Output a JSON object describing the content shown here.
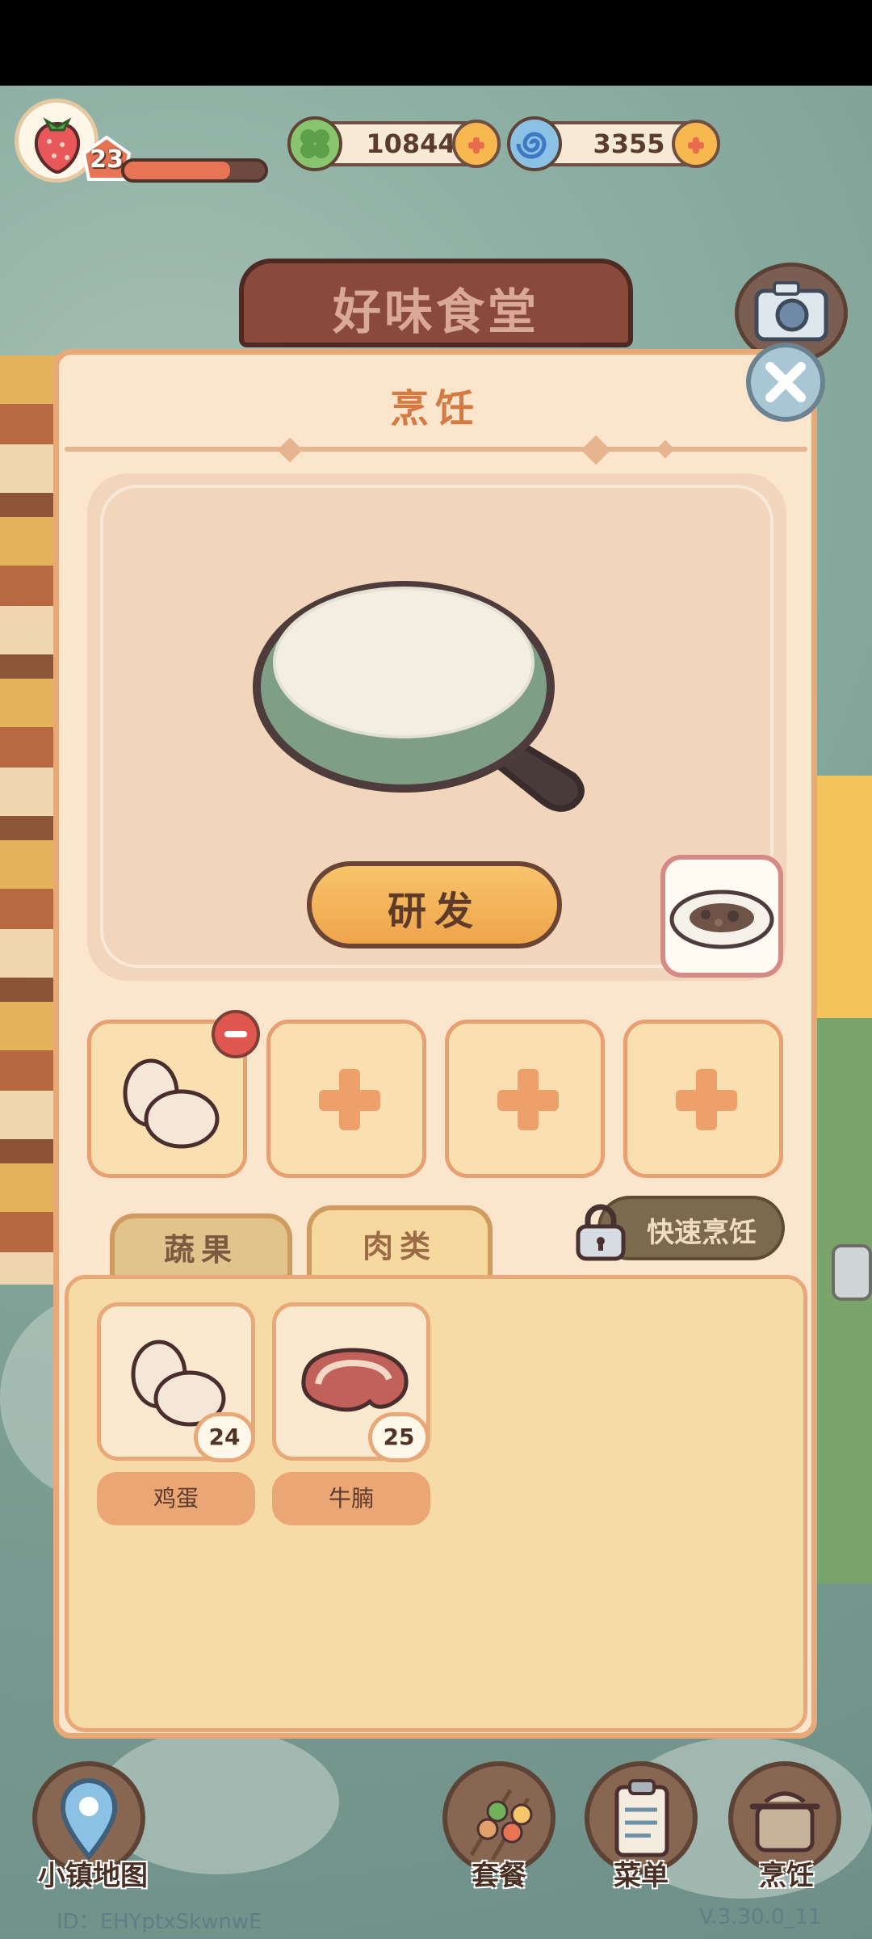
{
  "hud": {
    "level": "23",
    "xp_progress": 0.75,
    "currency_green": "10844",
    "currency_blue": "3355"
  },
  "sign": {
    "title": "好味食堂"
  },
  "panel": {
    "title": "烹饪",
    "research_label": "研发",
    "tabs": [
      {
        "label": "蔬果"
      },
      {
        "label": "肉类"
      }
    ],
    "quick_cook_label": "快速烹饪"
  },
  "ingredients": [
    {
      "name": "鸡蛋",
      "count": "24",
      "icon": "egg-icon"
    },
    {
      "name": "牛腩",
      "count": "25",
      "icon": "beef-icon"
    }
  ],
  "bottom_nav": {
    "map_label": "小镇地图",
    "set_meal_label": "套餐",
    "menu_label": "菜单",
    "cook_label": "烹饪"
  },
  "footer": {
    "id_text": "ID：EHYptxSkwnwE",
    "version": "V.3.30.0_11"
  },
  "colors": {
    "accent_orange": "#eda06a",
    "panel_bg": "#fbe6cd",
    "title_color": "#d47a42"
  }
}
